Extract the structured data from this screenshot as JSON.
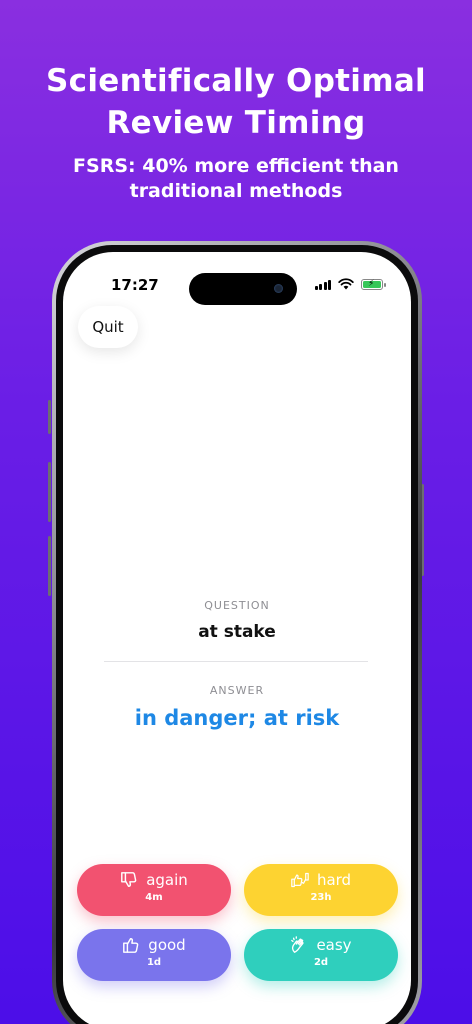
{
  "promo": {
    "headline": "Scientifically Optimal Review Timing",
    "subline": "FSRS: 40% more efficient than traditional methods"
  },
  "status_bar": {
    "time": "17:27",
    "battery_charging": true
  },
  "quit": {
    "label": "Quit"
  },
  "card": {
    "question_label": "QUESTION",
    "question": "at stake",
    "answer_label": "ANSWER",
    "answer": "in danger; at risk",
    "answer_color": "#1e88e5"
  },
  "ratings": [
    {
      "label": "again",
      "interval": "4m",
      "icon": "thumbs-down-icon",
      "color": "#f25270"
    },
    {
      "label": "hard",
      "interval": "23h",
      "icon": "thumbs-mixed-icon",
      "color": "#fdd331"
    },
    {
      "label": "good",
      "interval": "1d",
      "icon": "thumbs-up-icon",
      "color": "#7a74ec"
    },
    {
      "label": "easy",
      "interval": "2d",
      "icon": "clapping-hands-icon",
      "color": "#2fcfbd"
    }
  ],
  "background_gradient": [
    "#8a2fe0",
    "#4c0ee8"
  ]
}
